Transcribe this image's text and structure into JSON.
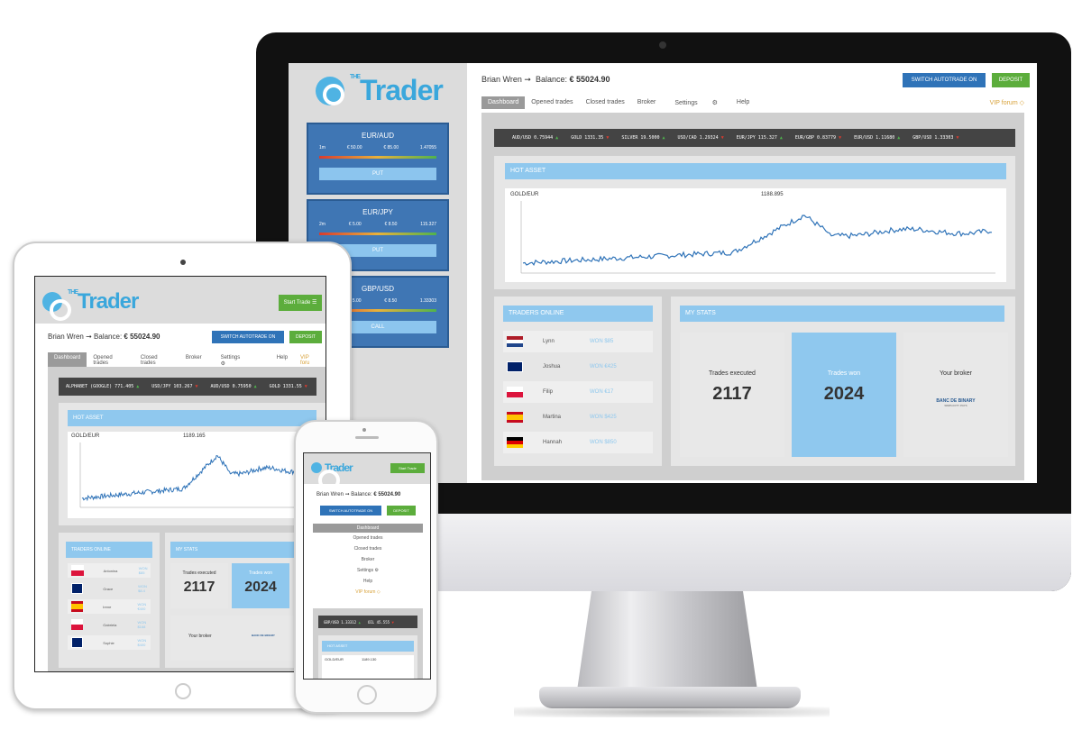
{
  "app": {
    "brand_small": "THE",
    "brand_name": "Trader",
    "user": "Brian Wren",
    "balance_label": "Balance:",
    "balance_value": "€ 55024.90",
    "switch_autotrade": "SWITCH AUTOTRADE ON",
    "deposit": "DEPOSIT",
    "start_trade": "Start Trade",
    "vip_forum": "VIP forum",
    "vip_forum_tablet": "VIP foru",
    "nav": [
      "Dashboard",
      "Opened trades",
      "Closed trades",
      "Broker",
      "Settings",
      "Help"
    ]
  },
  "sidebar": {
    "pairs": [
      {
        "name": "EUR/AUD",
        "time": "1m",
        "stake": "€ 50.00",
        "payout": "€ 85.00",
        "rate": "1.47055",
        "action": "PUT"
      },
      {
        "name": "EUR/JPY",
        "time": "2m",
        "stake": "€ 5.00",
        "payout": "€ 8.50",
        "rate": "115.327",
        "action": "PUT"
      },
      {
        "name": "GBP/USD",
        "time": "2m",
        "stake": "€ 5.00",
        "payout": "€ 8.50",
        "rate": "1.33303",
        "action": "CALL"
      }
    ]
  },
  "ticker": {
    "desktop": [
      "AUD/USD 0.75944",
      "GOLD 1331.35",
      "SILVER 19.5000",
      "USD/CAD 1.29324",
      "EUR/JPY 115.327",
      "EUR/GBP 0.83779",
      "EUR/USD 1.11680",
      "GBP/USD 1.33303"
    ],
    "tablet": [
      "ALPHABET (GOOGLE) 771.405",
      "USD/JPY 103.267",
      "AUD/USD 0.75950",
      "GOLD 1331.55"
    ],
    "phone": [
      "GBP/USD 1.33312",
      "OIL 45.555"
    ]
  },
  "hot_asset": {
    "title": "HOT ASSET",
    "asset": "GOLD/EUR",
    "value_desktop": "1188.895",
    "value_tablet": "1189.165",
    "value_phone": "1189.130"
  },
  "traders_online": {
    "title": "TRADERS ONLINE",
    "desktop": [
      {
        "name": "Lynn",
        "won": "WON $85",
        "flag": "nl"
      },
      {
        "name": "Joshua",
        "won": "WON €425",
        "flag": "uk"
      },
      {
        "name": "Filip",
        "won": "WON €17",
        "flag": "pl"
      },
      {
        "name": "Martina",
        "won": "WON $425",
        "flag": "es"
      },
      {
        "name": "Hannah",
        "won": "WON $850",
        "flag": "de"
      }
    ],
    "tablet": [
      {
        "name": "Antonina",
        "won": "WON $85",
        "flag": "pl"
      },
      {
        "name": "Grace",
        "won": "WON $8.4",
        "flag": "uk"
      },
      {
        "name": "Irene",
        "won": "WON €400",
        "flag": "es"
      },
      {
        "name": "Gabriela",
        "won": "WON $168",
        "flag": "pl"
      },
      {
        "name": "Sophie",
        "won": "WON $400",
        "flag": "uk"
      }
    ]
  },
  "my_stats": {
    "title": "MY STATS",
    "trades_executed_label": "Trades executed",
    "trades_executed": "2117",
    "trades_won_label": "Trades won",
    "trades_won": "2024",
    "your_broker_label": "Your broker",
    "broker_name": "BANC DE BINARY",
    "broker_tagline": "SIMPLICITY PAYS"
  },
  "colors": {
    "accent_blue": "#2f73b8",
    "light_blue": "#8fc8ee",
    "green": "#5cad3c",
    "vip_gold": "#d8a23a"
  },
  "icons": [
    "logo-icon",
    "logout-icon",
    "gear-icon",
    "diamond-icon",
    "menu-icon",
    "up-arrow-icon",
    "down-arrow-icon"
  ]
}
